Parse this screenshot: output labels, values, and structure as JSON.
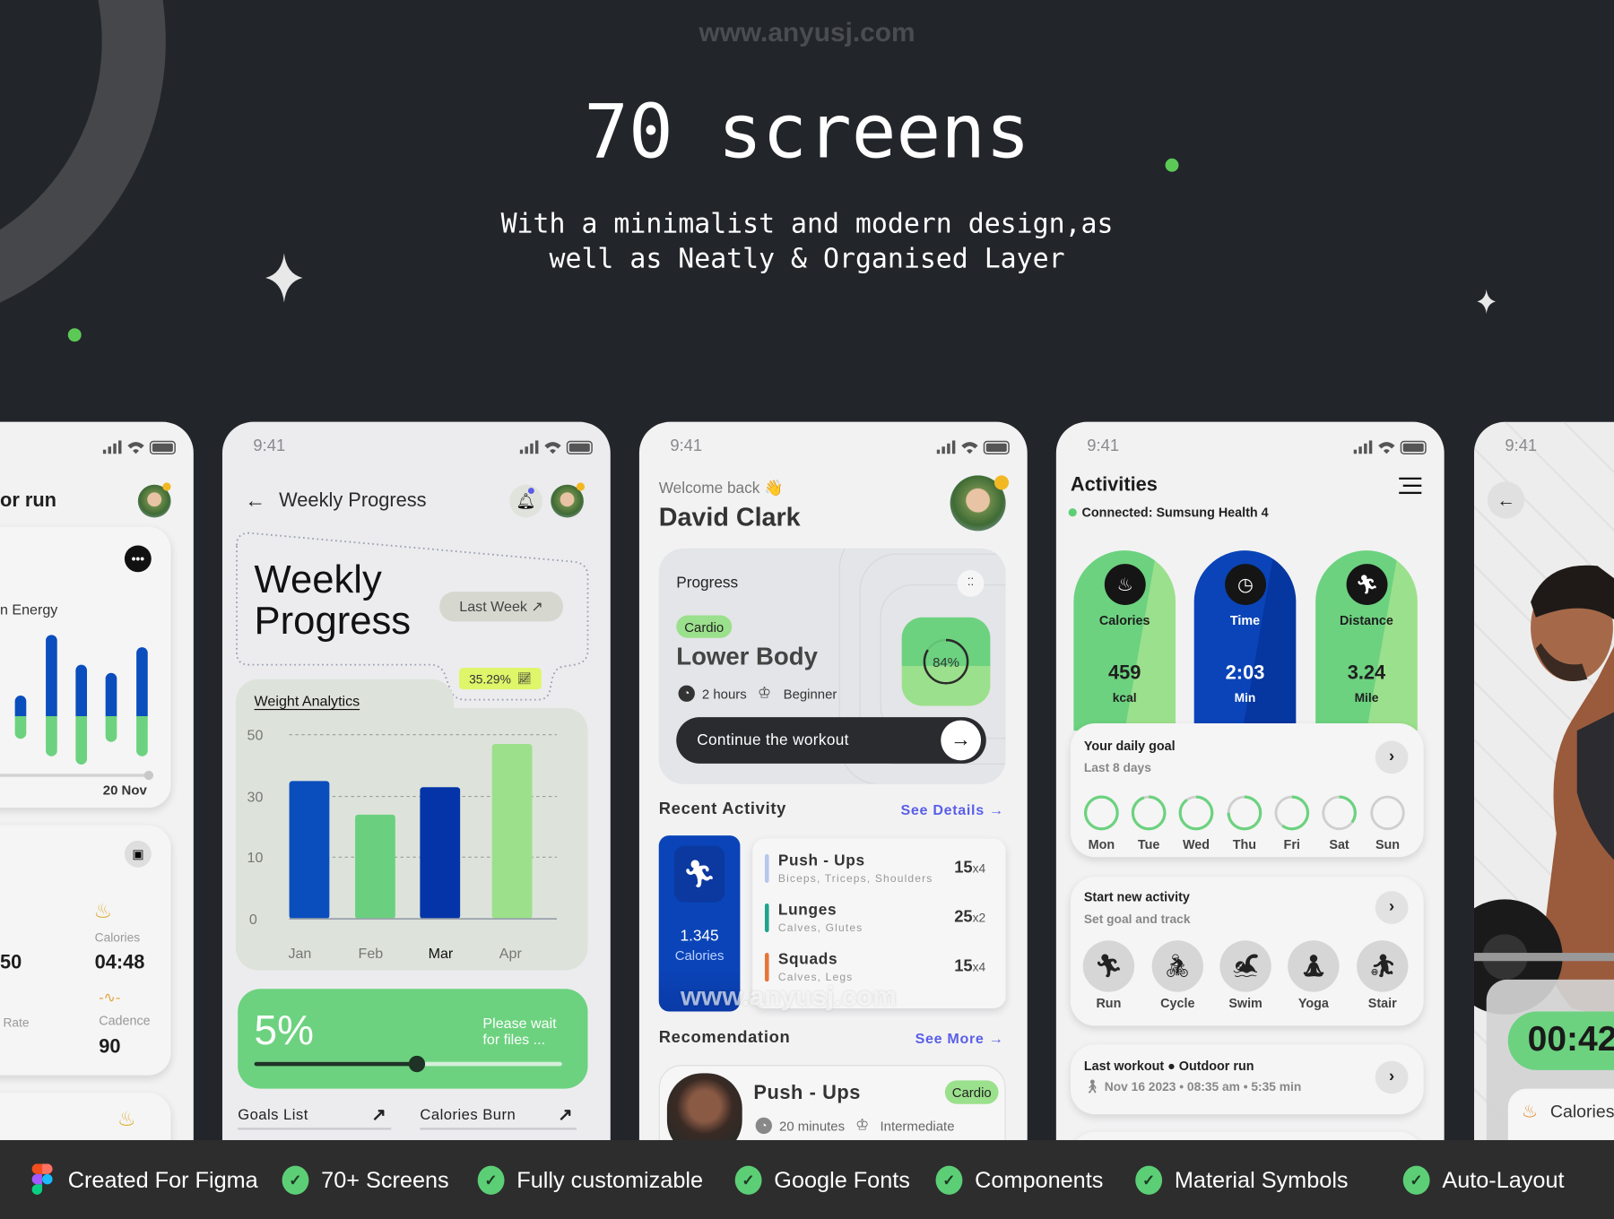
{
  "header": {
    "watermark": "www.anyusj.com",
    "title": "70 screens",
    "subtitle_lines": [
      "With a minimalist and modern design,as",
      "well as Neatly & Organised Layer"
    ]
  },
  "colors": {
    "background": "#22252a",
    "green": "#6cd27f",
    "light_green": "#9be08c",
    "blue": "#0a4dbd",
    "dark_blue": "#0534a8",
    "link": "#5a5fe6",
    "footer": "#2d2d2d"
  },
  "phone1": {
    "title": "or run",
    "chart_label": "n Energy",
    "date": "20 Nov",
    "energy_bars": {
      "blue": [
        20,
        79,
        50,
        42,
        67
      ],
      "green": [
        22,
        39,
        47,
        25,
        39
      ]
    },
    "stats": {
      "calories_label": "Calories",
      "left_value": "50",
      "calories_value": "04:48",
      "rate_label": "Rate",
      "cadence_label": "Cadence",
      "cadence_value": "90"
    }
  },
  "phone2": {
    "time": "9:41",
    "nav_title": "Weekly Progress",
    "hero_line1": "Weekly",
    "hero_line2": "Progress",
    "period_button": "Last Week ↗",
    "change_badge": "35.29%",
    "chart_title": "Weight Analytics",
    "chart": {
      "type": "bar",
      "categories": [
        "Jan",
        "Feb",
        "Mar",
        "Apr"
      ],
      "values": [
        35,
        24,
        33,
        47
      ],
      "y_ticks": [
        "50",
        "30",
        "10",
        "0"
      ],
      "highlighted": "Mar",
      "bar_colors": [
        "#0a4dbd",
        "#6ad07f",
        "#0534a8",
        "#9ce08c"
      ],
      "grid": true
    },
    "upload": {
      "percent_label": "5%",
      "message_line1": "Please wait",
      "message_line2": "for files ...",
      "progress": 0.53
    },
    "links": [
      {
        "label": "Goals List",
        "arrow": "↗"
      },
      {
        "label": "Calories Burn",
        "arrow": "↗"
      }
    ]
  },
  "phone3": {
    "time": "9:41",
    "greeting": "Welcome back 👋",
    "user_name": "David Clark",
    "progress_card": {
      "title": "Progress",
      "tag": "Cardio",
      "workout": "Lower Body",
      "duration": "2 hours",
      "level": "Beginner",
      "percent": "84%",
      "percent_value": 0.84,
      "cta": "Continue the workout",
      "cta_arrow": "→"
    },
    "recent": {
      "title": "Recent Activity",
      "link": "See Details →",
      "calories_value": "1.345",
      "calories_label": "Calories",
      "items": [
        {
          "name": "Push - Ups",
          "muscles": "Biceps, Triceps, Shoulders",
          "reps": "15",
          "sets": "x4",
          "color": "#b5c7ec"
        },
        {
          "name": "Lunges",
          "muscles": "Calves, Glutes",
          "reps": "25",
          "sets": "x2",
          "color": "#1fa38f"
        },
        {
          "name": "Squads",
          "muscles": "Calves, Legs",
          "reps": "15",
          "sets": "x4",
          "color": "#e6753a"
        }
      ]
    },
    "watermark": "www.anyusj.com",
    "recommendation": {
      "title": "Recomendation",
      "link": "See More →",
      "name": "Push - Ups",
      "tag": "Cardio",
      "duration": "20 minutes",
      "level": "Intermediate"
    }
  },
  "phone4": {
    "time": "9:41",
    "title": "Activities",
    "connection": "Connected: Sumsung Health 4",
    "metrics": [
      {
        "label": "Calories",
        "value": "459",
        "unit": "kcal",
        "icon": "campfire-icon"
      },
      {
        "label": "Time",
        "value": "2:03",
        "unit": "Min",
        "icon": "clock-icon"
      },
      {
        "label": "Distance",
        "value": "3.24",
        "unit": "Mile",
        "icon": "run-icon"
      }
    ],
    "daily_goal": {
      "title": "Your daily goal",
      "subtitle": "Last 8 days",
      "days": [
        {
          "label": "Mon",
          "progress": 1.0
        },
        {
          "label": "Tue",
          "progress": 0.95
        },
        {
          "label": "Wed",
          "progress": 0.9
        },
        {
          "label": "Thu",
          "progress": 0.75
        },
        {
          "label": "Fri",
          "progress": 0.6
        },
        {
          "label": "Sat",
          "progress": 0.35
        },
        {
          "label": "Sun",
          "progress": 0.0
        }
      ]
    },
    "new_activity": {
      "title": "Start new activity",
      "subtitle": "Set goal and track",
      "activities": [
        {
          "label": "Run",
          "icon": "run-icon"
        },
        {
          "label": "Cycle",
          "icon": "bike-icon"
        },
        {
          "label": "Swim",
          "icon": "swim-icon"
        },
        {
          "label": "Yoga",
          "icon": "yoga-icon"
        },
        {
          "label": "Stair",
          "icon": "stair-icon"
        }
      ]
    },
    "last_workout": {
      "title": "Last workout ● Outdoor run",
      "details": "Nov 16  2023 • 08:35 am • 5:35 min"
    }
  },
  "phone5": {
    "time": "9:41",
    "timer": "00:42",
    "stat_label": "Calories"
  },
  "footer": {
    "items": [
      {
        "label": "Created For Figma",
        "icon": "figma-logo"
      },
      {
        "label": "70+ Screens",
        "icon": "check-icon"
      },
      {
        "label": "Fully customizable",
        "icon": "check-icon"
      },
      {
        "label": "Google Fonts",
        "icon": "check-icon"
      },
      {
        "label": "Components",
        "icon": "check-icon"
      },
      {
        "label": "Material Symbols",
        "icon": "check-icon"
      },
      {
        "label": "Auto-Layout",
        "icon": "check-icon"
      }
    ]
  }
}
